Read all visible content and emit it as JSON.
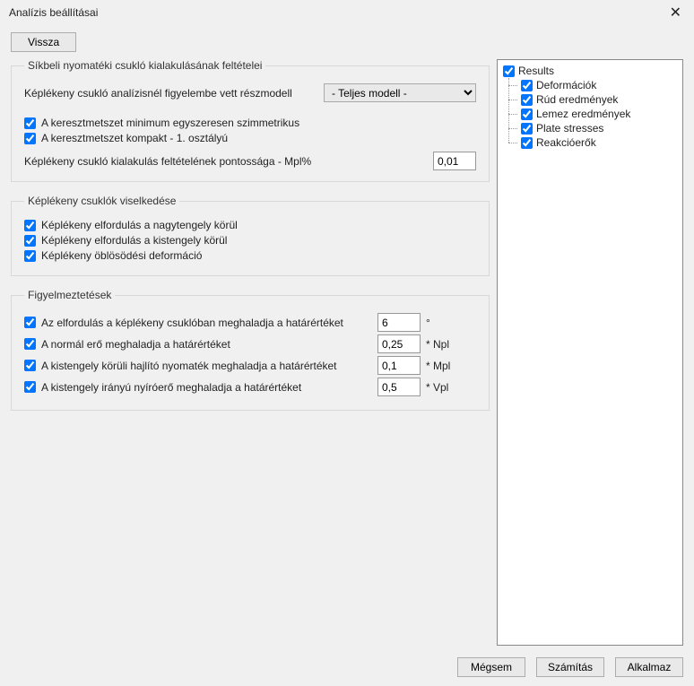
{
  "window": {
    "title": "Analízis beállításai",
    "back": "Vissza"
  },
  "group1": {
    "legend": "Síkbeli nyomatéki csukló kialakulásának feltételei",
    "submodel_label": "Képlékeny csukló analízisnél figyelembe vett részmodell",
    "submodel_value": "- Teljes modell -",
    "chk_sym": "A keresztmetszet minimum egyszeresen szimmetrikus",
    "chk_compact": "A keresztmetszet kompakt - 1. osztályú",
    "precision_label": "Képlékeny csukló kialakulás feltételének pontossága - Mpl%",
    "precision_value": "0,01"
  },
  "group2": {
    "legend": "Képlékeny csuklók viselkedése",
    "chk_major": "Képlékeny elfordulás a nagytengely körül",
    "chk_minor": "Képlékeny elfordulás a kistengely körül",
    "chk_warp": "Képlékeny öblösödési deformáció"
  },
  "group3": {
    "legend": "Figyelmeztetések",
    "w1_label": "Az elfordulás a képlékeny csuklóban meghaladja a határértéket",
    "w1_value": "6",
    "w1_unit": "°",
    "w2_label": "A normál erő meghaladja a határértéket",
    "w2_value": "0,25",
    "w2_unit": "* Npl",
    "w3_label": "A kistengely körüli hajlító nyomaték meghaladja a határértéket",
    "w3_value": "0,1",
    "w3_unit": "* Mpl",
    "w4_label": "A kistengely irányú nyíróerő meghaladja a határértéket",
    "w4_value": "0,5",
    "w4_unit": "* Vpl"
  },
  "tree": {
    "root": "Results",
    "items": {
      "0": "Deformációk",
      "1": "Rúd eredmények",
      "2": "Lemez eredmények",
      "3": "Plate stresses",
      "4": "Reakcióerők"
    }
  },
  "footer": {
    "cancel": "Mégsem",
    "compute": "Számítás",
    "apply": "Alkalmaz"
  }
}
